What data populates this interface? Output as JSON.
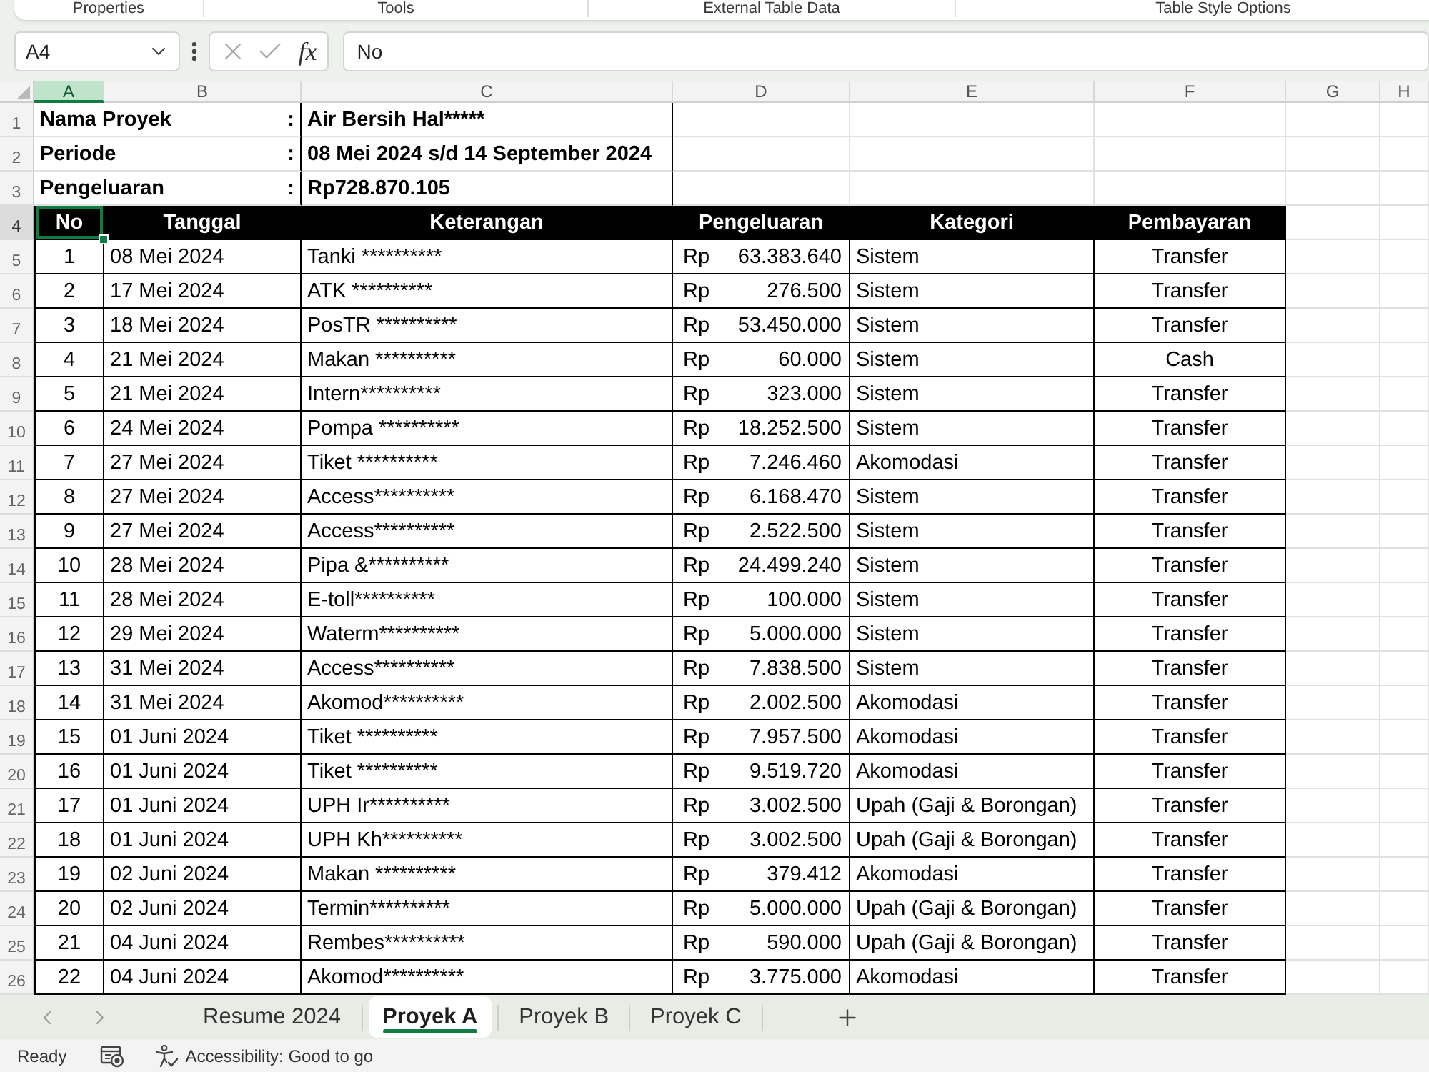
{
  "ribbon": {
    "groups": [
      "Properties",
      "Tools",
      "External Table Data",
      "Table Style Options"
    ]
  },
  "formula_bar": {
    "name_box": "A4",
    "function_label": "fx",
    "formula": "No"
  },
  "grid": {
    "columns": [
      {
        "label": "A",
        "selected": true
      },
      {
        "label": "B",
        "selected": false
      },
      {
        "label": "C",
        "selected": false
      },
      {
        "label": "D",
        "selected": false
      },
      {
        "label": "E",
        "selected": false
      },
      {
        "label": "F",
        "selected": false
      },
      {
        "label": "G",
        "selected": false
      },
      {
        "label": "H",
        "selected": false
      }
    ],
    "rows": [
      {
        "number": "1",
        "selected": false,
        "kind": "info",
        "label": "Nama Proyek",
        "separator": ":",
        "value": "Air Bersih Hal*****"
      },
      {
        "number": "2",
        "selected": false,
        "kind": "info",
        "label": "Periode",
        "separator": ":",
        "value": "08 Mei 2024 s/d 14 September 2024"
      },
      {
        "number": "3",
        "selected": false,
        "kind": "info",
        "label": "Pengeluaran",
        "separator": ":",
        "value": "Rp728.870.105"
      },
      {
        "number": "4",
        "selected": true,
        "kind": "header",
        "cells": [
          "No",
          "Tanggal",
          "Keterangan",
          "Pengeluaran",
          "Kategori",
          "Pembayaran"
        ]
      },
      {
        "number": "5",
        "selected": false,
        "kind": "data",
        "no": "1",
        "date": "08 Mei 2024",
        "description": "Tanki **********",
        "currency": "Rp",
        "amount": "63.383.640",
        "category": "Sistem",
        "payment": "Transfer"
      },
      {
        "number": "6",
        "selected": false,
        "kind": "data",
        "no": "2",
        "date": "17 Mei 2024",
        "description": "ATK **********",
        "currency": "Rp",
        "amount": "276.500",
        "category": "Sistem",
        "payment": "Transfer"
      },
      {
        "number": "7",
        "selected": false,
        "kind": "data",
        "no": "3",
        "date": "18 Mei 2024",
        "description": "PosTR **********",
        "currency": "Rp",
        "amount": "53.450.000",
        "category": "Sistem",
        "payment": "Transfer"
      },
      {
        "number": "8",
        "selected": false,
        "kind": "data",
        "no": "4",
        "date": "21 Mei 2024",
        "description": "Makan **********",
        "currency": "Rp",
        "amount": "60.000",
        "category": "Sistem",
        "payment": "Cash"
      },
      {
        "number": "9",
        "selected": false,
        "kind": "data",
        "no": "5",
        "date": "21 Mei 2024",
        "description": "Intern**********",
        "currency": "Rp",
        "amount": "323.000",
        "category": "Sistem",
        "payment": "Transfer"
      },
      {
        "number": "10",
        "selected": false,
        "kind": "data",
        "no": "6",
        "date": "24 Mei 2024",
        "description": "Pompa **********",
        "currency": "Rp",
        "amount": "18.252.500",
        "category": "Sistem",
        "payment": "Transfer"
      },
      {
        "number": "11",
        "selected": false,
        "kind": "data",
        "no": "7",
        "date": "27 Mei 2024",
        "description": "Tiket **********",
        "currency": "Rp",
        "amount": "7.246.460",
        "category": "Akomodasi",
        "payment": "Transfer"
      },
      {
        "number": "12",
        "selected": false,
        "kind": "data",
        "no": "8",
        "date": "27 Mei 2024",
        "description": "Access**********",
        "currency": "Rp",
        "amount": "6.168.470",
        "category": "Sistem",
        "payment": "Transfer"
      },
      {
        "number": "13",
        "selected": false,
        "kind": "data",
        "no": "9",
        "date": "27 Mei 2024",
        "description": "Access**********",
        "currency": "Rp",
        "amount": "2.522.500",
        "category": "Sistem",
        "payment": "Transfer"
      },
      {
        "number": "14",
        "selected": false,
        "kind": "data",
        "no": "10",
        "date": "28 Mei 2024",
        "description": "Pipa &**********",
        "currency": "Rp",
        "amount": "24.499.240",
        "category": "Sistem",
        "payment": "Transfer"
      },
      {
        "number": "15",
        "selected": false,
        "kind": "data",
        "no": "11",
        "date": "28 Mei 2024",
        "description": "E-toll**********",
        "currency": "Rp",
        "amount": "100.000",
        "category": "Sistem",
        "payment": "Transfer"
      },
      {
        "number": "16",
        "selected": false,
        "kind": "data",
        "no": "12",
        "date": "29 Mei 2024",
        "description": "Waterm**********",
        "currency": "Rp",
        "amount": "5.000.000",
        "category": "Sistem",
        "payment": "Transfer"
      },
      {
        "number": "17",
        "selected": false,
        "kind": "data",
        "no": "13",
        "date": "31 Mei 2024",
        "description": "Access**********",
        "currency": "Rp",
        "amount": "7.838.500",
        "category": "Sistem",
        "payment": "Transfer"
      },
      {
        "number": "18",
        "selected": false,
        "kind": "data",
        "no": "14",
        "date": "31 Mei 2024",
        "description": "Akomod**********",
        "currency": "Rp",
        "amount": "2.002.500",
        "category": "Akomodasi",
        "payment": "Transfer"
      },
      {
        "number": "19",
        "selected": false,
        "kind": "data",
        "no": "15",
        "date": "01 Juni 2024",
        "description": "Tiket **********",
        "currency": "Rp",
        "amount": "7.957.500",
        "category": "Akomodasi",
        "payment": "Transfer"
      },
      {
        "number": "20",
        "selected": false,
        "kind": "data",
        "no": "16",
        "date": "01 Juni 2024",
        "description": "Tiket **********",
        "currency": "Rp",
        "amount": "9.519.720",
        "category": "Akomodasi",
        "payment": "Transfer"
      },
      {
        "number": "21",
        "selected": false,
        "kind": "data",
        "no": "17",
        "date": "01 Juni 2024",
        "description": "UPH Ir**********",
        "currency": "Rp",
        "amount": "3.002.500",
        "category": "Upah (Gaji & Borongan)",
        "payment": "Transfer"
      },
      {
        "number": "22",
        "selected": false,
        "kind": "data",
        "no": "18",
        "date": "01 Juni 2024",
        "description": "UPH Kh**********",
        "currency": "Rp",
        "amount": "3.002.500",
        "category": "Upah (Gaji & Borongan)",
        "payment": "Transfer"
      },
      {
        "number": "23",
        "selected": false,
        "kind": "data",
        "no": "19",
        "date": "02 Juni 2024",
        "description": "Makan **********",
        "currency": "Rp",
        "amount": "379.412",
        "category": "Akomodasi",
        "payment": "Transfer"
      },
      {
        "number": "24",
        "selected": false,
        "kind": "data",
        "no": "20",
        "date": "02 Juni 2024",
        "description": "Termin**********",
        "currency": "Rp",
        "amount": "5.000.000",
        "category": "Upah (Gaji & Borongan)",
        "payment": "Transfer"
      },
      {
        "number": "25",
        "selected": false,
        "kind": "data",
        "no": "21",
        "date": "04 Juni 2024",
        "description": "Rembes**********",
        "currency": "Rp",
        "amount": "590.000",
        "category": "Upah (Gaji & Borongan)",
        "payment": "Transfer"
      },
      {
        "number": "26",
        "selected": false,
        "kind": "data",
        "no": "22",
        "date": "04 Juni 2024",
        "description": "Akomod**********",
        "currency": "Rp",
        "amount": "3.775.000",
        "category": "Akomodasi",
        "payment": "Transfer"
      }
    ]
  },
  "sheet_tabs": [
    {
      "label": "Resume 2024",
      "selected": false
    },
    {
      "label": "Proyek A",
      "selected": true
    },
    {
      "label": "Proyek B",
      "selected": false
    },
    {
      "label": "Proyek C",
      "selected": false
    }
  ],
  "status_bar": {
    "status": "Ready",
    "accessibility": "Accessibility: Good to go"
  }
}
